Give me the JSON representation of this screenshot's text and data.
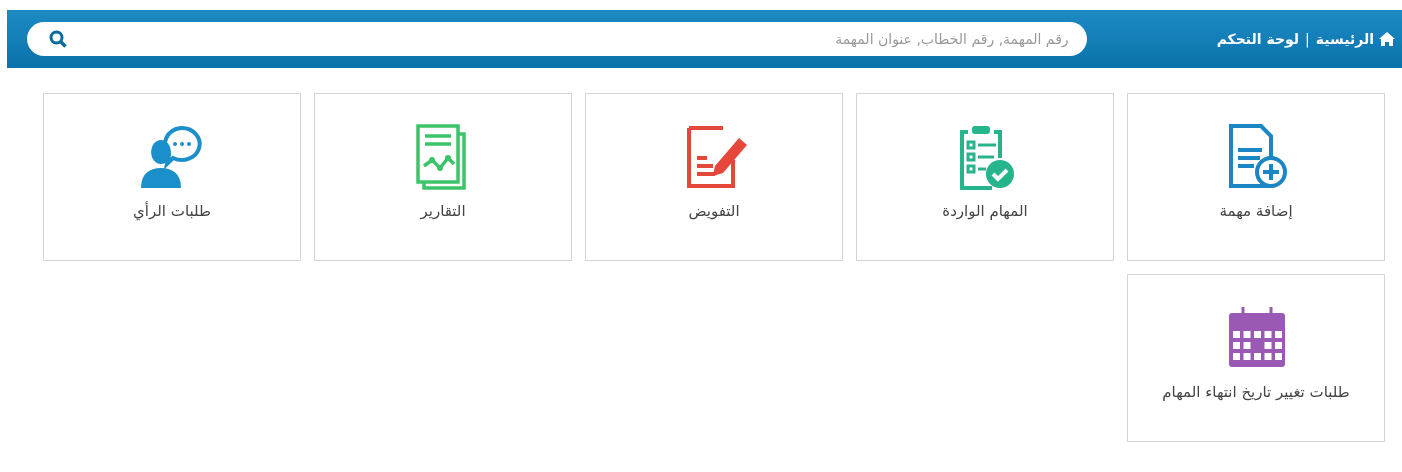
{
  "header": {
    "breadcrumb": [
      {
        "label": "الرئيسية",
        "kind": "home"
      },
      {
        "label": "|",
        "kind": "separator"
      },
      {
        "label": "لوحة التحكم",
        "kind": "link"
      }
    ],
    "search": {
      "placeholder": "رقم المهمة, رقم الخطاب, عنوان المهمة"
    }
  },
  "tiles": [
    {
      "label": "إضافة مهمة",
      "kind": "add-document"
    },
    {
      "label": "المهام الواردة",
      "kind": "clipboard-check"
    },
    {
      "label": "التفويض",
      "kind": "document-pen"
    },
    {
      "label": "التقارير",
      "kind": "report"
    },
    {
      "label": "طلبات الرأي",
      "kind": "feedback"
    },
    {
      "label": "طلبات تغيير تاريخ انتهاء المهام",
      "kind": "calendar"
    }
  ]
}
